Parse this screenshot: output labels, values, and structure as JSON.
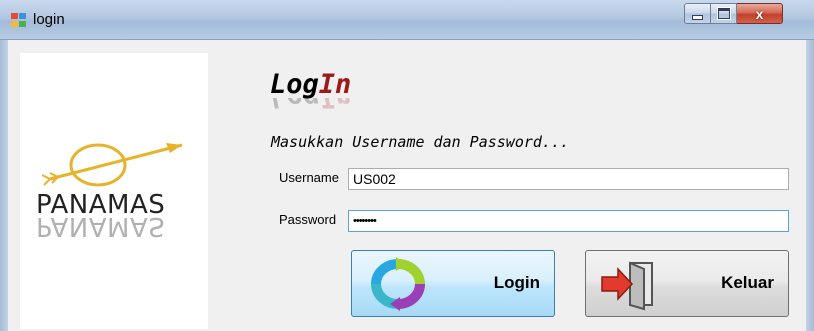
{
  "window": {
    "title": "login",
    "close_glyph": "x",
    "icons": [
      "app-icon",
      "minimize-icon",
      "maximize-icon",
      "close-icon"
    ]
  },
  "logo": {
    "brand": "PANAMAS",
    "icon": "arrow-circle-logo"
  },
  "form": {
    "heading_part1": "Log",
    "heading_part2": "In",
    "subtitle": "Masukkan Username dan Password...",
    "username_label": "Username",
    "username_value": "US002",
    "password_label": "Password",
    "password_value": "••••••••",
    "login_label": "Login",
    "keluar_label": "Keluar",
    "login_icon": "refresh-cycle-icon",
    "keluar_icon": "exit-door-icon"
  },
  "colors": {
    "accent_red": "#9b1b1b",
    "focus_border": "#5aa3dd"
  }
}
